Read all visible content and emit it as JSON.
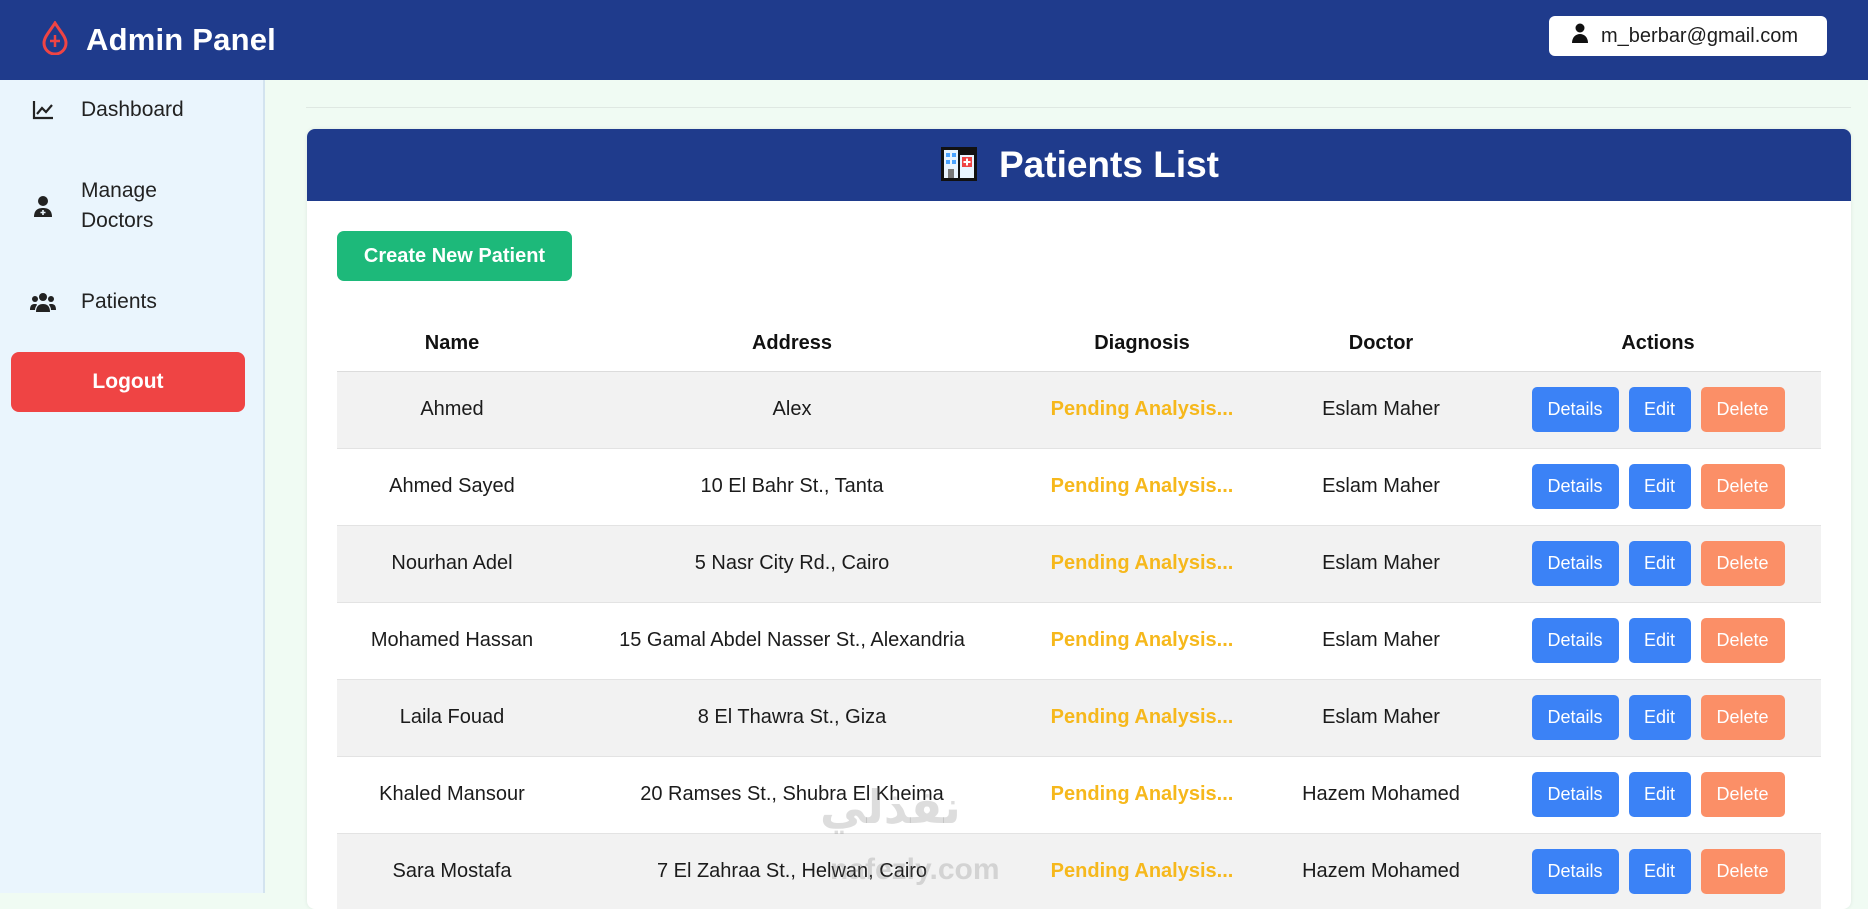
{
  "header": {
    "brand_title": "Admin Panel",
    "brand_icon": "blood-drop-icon",
    "user_email": "m_berbar@gmail.com",
    "user_icon": "user-icon",
    "bg_color": "#1f3b8c"
  },
  "sidebar": {
    "items": [
      {
        "label": "Dashboard",
        "icon": "chart-line-icon"
      },
      {
        "label": "Manage Doctors",
        "icon": "user-doctor-icon"
      },
      {
        "label": "Patients",
        "icon": "users-icon"
      }
    ],
    "logout_label": "Logout",
    "logout_color": "#ef4444"
  },
  "main": {
    "title": "Patients List",
    "title_icon": "hospital-icon",
    "create_label": "Create New Patient",
    "create_color": "#1db97a",
    "columns": [
      "Name",
      "Address",
      "Diagnosis",
      "Doctor",
      "Actions"
    ],
    "rows": [
      {
        "name": "Ahmed",
        "address": "Alex",
        "diagnosis": "Pending Analysis...",
        "doctor": "Eslam Maher"
      },
      {
        "name": "Ahmed Sayed",
        "address": "10 El Bahr St., Tanta",
        "diagnosis": "Pending Analysis...",
        "doctor": "Eslam Maher"
      },
      {
        "name": "Nourhan Adel",
        "address": "5 Nasr City Rd., Cairo",
        "diagnosis": "Pending Analysis...",
        "doctor": "Eslam Maher"
      },
      {
        "name": "Mohamed Hassan",
        "address": "15 Gamal Abdel Nasser St., Alexandria",
        "diagnosis": "Pending Analysis...",
        "doctor": "Eslam Maher"
      },
      {
        "name": "Laila Fouad",
        "address": "8 El Thawra St., Giza",
        "diagnosis": "Pending Analysis...",
        "doctor": "Eslam Maher"
      },
      {
        "name": "Khaled Mansour",
        "address": "20 Ramses St., Shubra El Kheima",
        "diagnosis": "Pending Analysis...",
        "doctor": "Hazem Mohamed"
      },
      {
        "name": "Sara Mostafa",
        "address": "7 El Zahraa St., Helwan, Cairo",
        "diagnosis": "Pending Analysis...",
        "doctor": "Hazem Mohamed"
      }
    ],
    "action_labels": {
      "details": "Details",
      "edit": "Edit",
      "delete": "Delete"
    },
    "diagnosis_color": "#f6b81c"
  },
  "watermark": {
    "text": "نفذلي",
    "sub": "nafezly.com"
  }
}
